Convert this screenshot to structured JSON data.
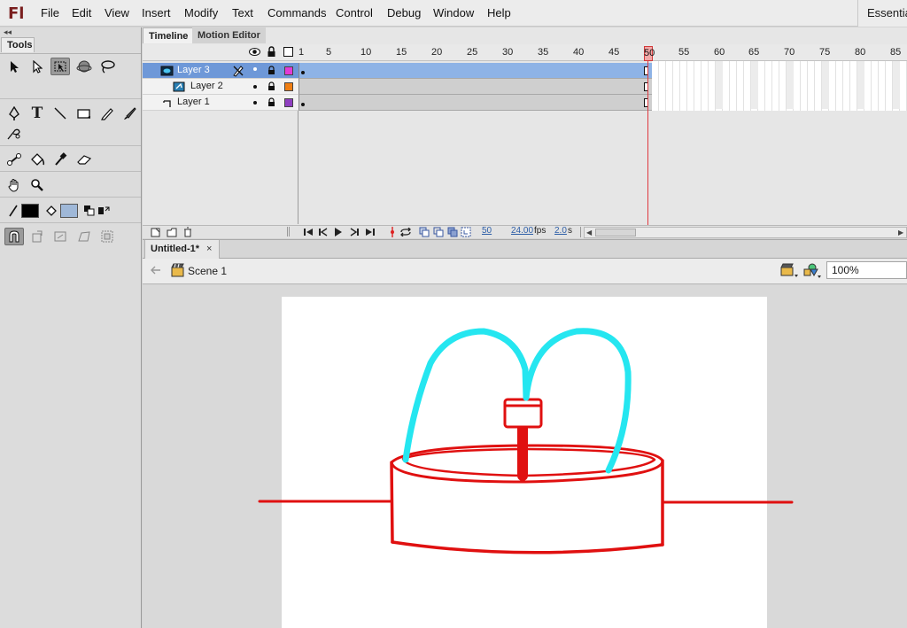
{
  "app": {
    "logo": "Fl",
    "menu": [
      "File",
      "Edit",
      "View",
      "Insert",
      "Modify",
      "Text",
      "Commands",
      "Control",
      "Debug",
      "Window",
      "Help"
    ],
    "workspace": "Essentials"
  },
  "tools": {
    "collapse_glyph": "◂◂",
    "title": "Tools",
    "icons": [
      "selection-tool",
      "subselection-tool",
      "free-transform-tool",
      "3d-rotation-tool",
      "lasso-tool",
      "pen-tool",
      "text-tool",
      "line-tool",
      "rectangle-tool",
      "pencil-tool",
      "brush-tool",
      "deco-tool",
      "bone-tool",
      "paint-bucket-tool",
      "eyedropper-tool",
      "eraser-tool",
      "hand-tool",
      "zoom-tool",
      "stroke-color",
      "fill-color",
      "black-white",
      "swap-colors",
      "snap-to-objects",
      "rotate-option",
      "scale-option",
      "skew-option",
      "smooth-option"
    ],
    "text_tool_glyph": "T",
    "stroke_color": "#000000",
    "fill_color": "#9fb8d8"
  },
  "timeline": {
    "tabs": [
      "Timeline",
      "Motion Editor"
    ],
    "frame_numbers": [
      "1",
      "5",
      "10",
      "15",
      "20",
      "25",
      "30",
      "35",
      "40",
      "45",
      "50",
      "55",
      "60",
      "65",
      "70",
      "75",
      "80",
      "85"
    ],
    "current_frame": "50",
    "layers": [
      {
        "name": "Layer 3",
        "active": true,
        "color": "#e23bd6"
      },
      {
        "name": "Layer 2",
        "active": false,
        "color": "#f07f14"
      },
      {
        "name": "Layer 1",
        "active": false,
        "color": "#8f3fc0"
      }
    ],
    "footer": {
      "frame": "50",
      "fps": "24.00",
      "fps_unit": "fps",
      "time": "2.0",
      "time_unit": "s"
    }
  },
  "document": {
    "tab_title": "Untitled-1*",
    "tab_close": "×",
    "scene": "Scene 1",
    "zoom": "100%",
    "colors": {
      "fountain_body": "#e01010",
      "water": "#25e6f0"
    }
  }
}
